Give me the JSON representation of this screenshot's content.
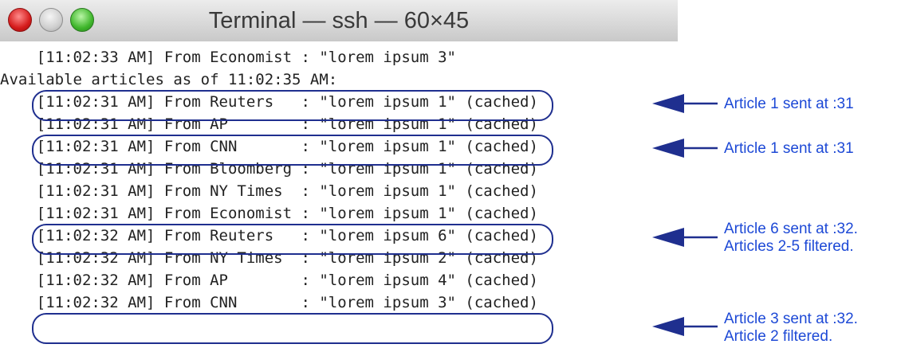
{
  "window": {
    "title": "Terminal — ssh — 60×45"
  },
  "colors": {
    "annotation_text": "#1d49d6",
    "annotation_shape": "#1f2f8f",
    "terminal_text": "#222222"
  },
  "terminal": {
    "lines": [
      "    [11:02:33 AM] From Economist : \"lorem ipsum 3\"",
      "Available articles as of 11:02:35 AM:",
      "    [11:02:31 AM] From Reuters   : \"lorem ipsum 1\" (cached)",
      "    [11:02:31 AM] From AP        : \"lorem ipsum 1\" (cached)",
      "    [11:02:31 AM] From CNN       : \"lorem ipsum 1\" (cached)",
      "    [11:02:31 AM] From Bloomberg : \"lorem ipsum 1\" (cached)",
      "    [11:02:31 AM] From NY Times  : \"lorem ipsum 1\" (cached)",
      "    [11:02:31 AM] From Economist : \"lorem ipsum 1\" (cached)",
      "    [11:02:32 AM] From Reuters   : \"lorem ipsum 6\" (cached)",
      "    [11:02:32 AM] From NY Times  : \"lorem ipsum 2\" (cached)",
      "    [11:02:32 AM] From AP        : \"lorem ipsum 4\" (cached)",
      "    [11:02:32 AM] From CNN       : \"lorem ipsum 3\" (cached)"
    ]
  },
  "annotations": [
    {
      "text": "Article 1 sent at :31"
    },
    {
      "text": "Article 1 sent at :31"
    },
    {
      "text": "Article 6 sent at :32.\nArticles 2-5 filtered."
    },
    {
      "text": "Article 3 sent at :32.\nArticle 2 filtered."
    }
  ]
}
